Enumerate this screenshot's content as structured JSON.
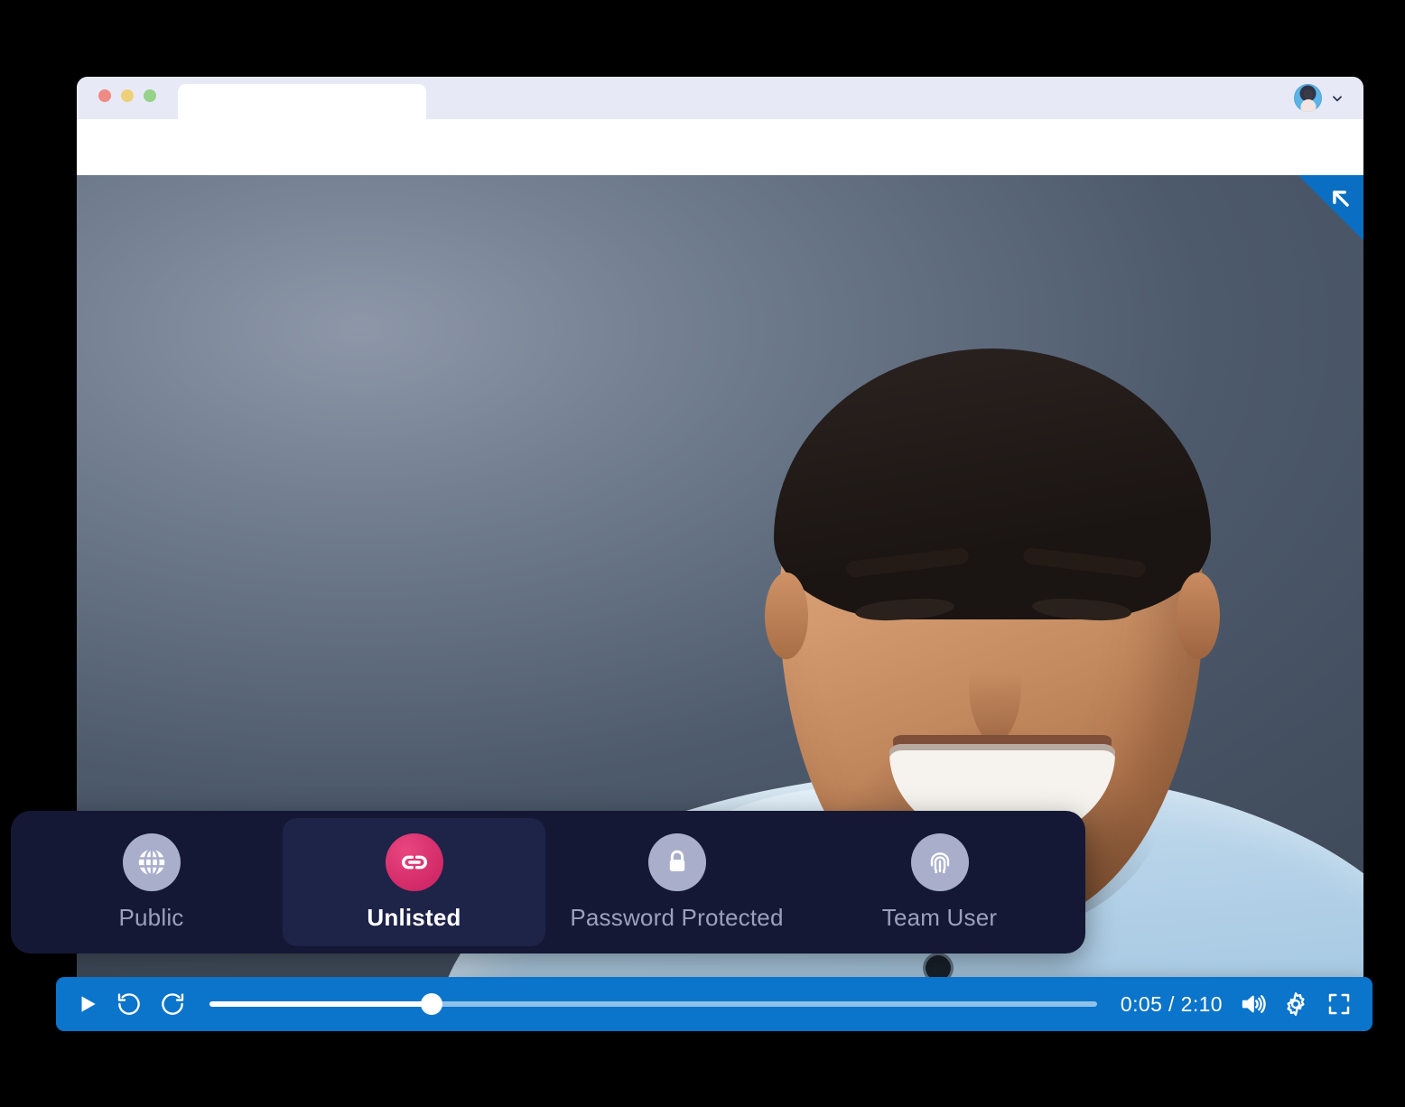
{
  "window": {
    "traffic_lights": [
      "close",
      "minimize",
      "maximize"
    ],
    "tab_title": "",
    "account_chevron": "chevron-down-icon",
    "avatar": "user-avatar"
  },
  "video": {
    "corner_badge_icon": "collapse-arrow-icon"
  },
  "privacy": {
    "options": [
      {
        "label": "Public",
        "icon": "globe-icon",
        "active": false
      },
      {
        "label": "Unlisted",
        "icon": "link-icon",
        "active": true
      },
      {
        "label": "Password Protected",
        "icon": "lock-icon",
        "active": false
      },
      {
        "label": "Team User",
        "icon": "fingerprint-icon",
        "active": false
      }
    ],
    "selected": "Unlisted",
    "active_accent": "#d22a68",
    "bar_color": "#141834",
    "active_card_color": "#1e2348",
    "inactive_icon_color": "#a9afcb"
  },
  "player": {
    "play_label": "play-icon",
    "rewind_label": "rewind-icon",
    "forward_label": "forward-icon",
    "current_time": "0:05",
    "duration": "2:10",
    "time_display": "0:05 / 2:10",
    "progress_percent": 25,
    "volume_label": "volume-icon",
    "settings_label": "settings-gear-icon",
    "fullscreen_label": "fullscreen-icon",
    "bar_color": "#0b74cb"
  }
}
